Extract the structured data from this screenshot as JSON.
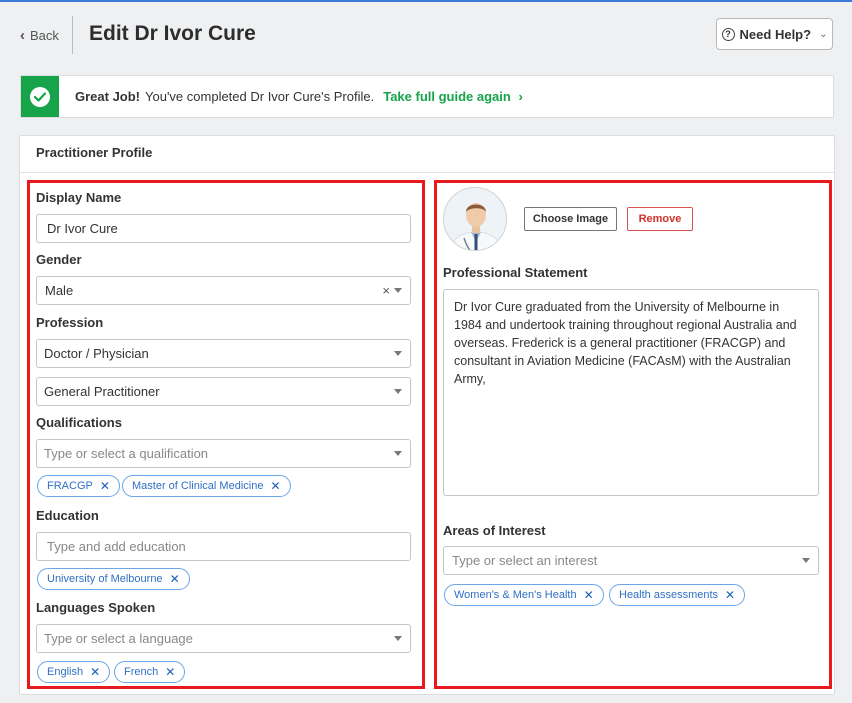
{
  "header": {
    "back_label": "Back",
    "title": "Edit Dr Ivor Cure",
    "help_label": "Need Help?"
  },
  "banner": {
    "strong": "Great Job!",
    "message": "You've completed Dr Ivor Cure's Profile.",
    "link": "Take full guide again",
    "link_chevron": "›",
    "accent_color": "#16a34a"
  },
  "panel": {
    "title": "Practitioner Profile"
  },
  "left": {
    "display_name": {
      "label": "Display Name",
      "value": "Dr Ivor Cure"
    },
    "gender": {
      "label": "Gender",
      "value": "Male"
    },
    "profession": {
      "label": "Profession",
      "value": "Doctor / Physician",
      "specialty": "General Practitioner"
    },
    "qualifications": {
      "label": "Qualifications",
      "placeholder": "Type or select a qualification",
      "tags": [
        "FRACGP",
        "Master of Clinical Medicine"
      ]
    },
    "education": {
      "label": "Education",
      "placeholder": "Type and add education",
      "tags": [
        "University of Melbourne"
      ]
    },
    "languages": {
      "label": "Languages Spoken",
      "placeholder": "Type or select a language",
      "tags": [
        "English",
        "French"
      ]
    }
  },
  "right": {
    "choose_image": "Choose Image",
    "remove": "Remove",
    "statement_label": "Professional Statement",
    "statement": "Dr Ivor Cure graduated from the University of Melbourne in 1984 and undertook training throughout regional Australia and overseas. Frederick is a general practitioner (FRACGP) and consultant in Aviation Medicine (FACAsM) with the Australian Army,",
    "interests": {
      "label": "Areas of Interest",
      "placeholder": "Type or select an interest",
      "tags": [
        "Women's & Men's Health",
        "Health assessments"
      ]
    }
  },
  "icons": {
    "back": "chevron-left-icon",
    "help": "question-circle-icon",
    "success": "check-circle-icon",
    "tag_remove": "close-icon",
    "dropdown": "caret-down-icon",
    "clear": "clear-icon"
  },
  "colors": {
    "highlight_border": "#e8191c",
    "tag_blue": "#2f6fc4",
    "remove_red": "#d0312d"
  }
}
